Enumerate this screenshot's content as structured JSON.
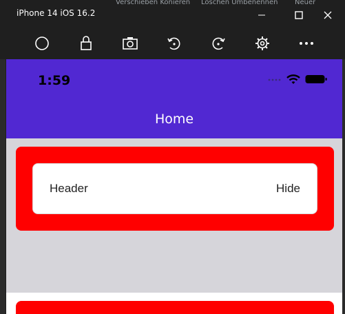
{
  "window": {
    "title": "iPhone 14 iOS 16.2",
    "behind_text": [
      "Verschieben Konieren",
      "Löschen Umbenennen",
      "Neuer"
    ]
  },
  "toolbar": {
    "icons": [
      "home-circle-icon",
      "lock-icon",
      "camera-icon",
      "rotate-left-icon",
      "rotate-right-icon",
      "gear-icon",
      "more-icon"
    ]
  },
  "phone": {
    "status": {
      "time": "1:59"
    },
    "nav": {
      "title": "Home"
    },
    "card": {
      "title": "Header",
      "action": "Hide"
    }
  },
  "colors": {
    "brand": "#5128d2",
    "card_accent": "#ff0000",
    "page_bg": "#d6d5da"
  }
}
